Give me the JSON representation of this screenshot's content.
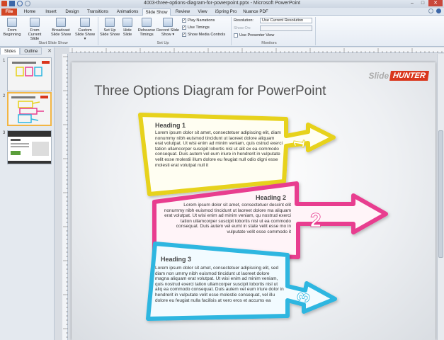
{
  "window": {
    "title": "4003-three-options-diagram-for-powerpoint.pptx - Microsoft PowerPoint",
    "min": "–",
    "max": "□",
    "close": "✕"
  },
  "tabs": [
    {
      "label": "File"
    },
    {
      "label": "Home"
    },
    {
      "label": "Insert"
    },
    {
      "label": "Design"
    },
    {
      "label": "Transitions"
    },
    {
      "label": "Animations"
    },
    {
      "label": "Slide Show"
    },
    {
      "label": "Review"
    },
    {
      "label": "View"
    },
    {
      "label": "iSpring Pro"
    },
    {
      "label": "Nuance PDF"
    }
  ],
  "ribbon": {
    "from_beginning": "From Beginning",
    "from_current": "From Current Slide",
    "broadcast": "Broadcast Slide Show",
    "custom": "Custom Slide Show ▾",
    "group_start": "Start Slide Show",
    "setup": "Set Up Slide Show",
    "hide": "Hide Slide",
    "rehearse": "Rehearse Timings",
    "record": "Record Slide Show ▾",
    "group_setup": "Set Up",
    "play_narrations": "Play Narrations",
    "use_timings": "Use Timings",
    "show_media": "Show Media Controls",
    "resolution_label": "Resolution:",
    "resolution_value": "Use Current Resolution",
    "show_on_label": "Show On:",
    "presenter_view": "Use Presenter View",
    "group_monitors": "Monitors"
  },
  "pane": {
    "tab_slides": "Slides",
    "tab_outline": "Outline",
    "close": "✕",
    "nums": [
      "1",
      "2",
      "3"
    ]
  },
  "slide": {
    "title": "Three Options Diagram for PowerPoint",
    "logo_a": "Slide",
    "logo_b": "HUNTER",
    "options": [
      {
        "heading": "Heading 1",
        "number": "1",
        "color": "#e7d21a",
        "text": "Lorem ipsum dolor sit amet, consectetuer adipiscing elit, diam nonummy nibh euismod tincidunt ut laoreet dolore aliquam erat volutpat. Ut wisi enim ad minim veniam, quis ostrud exerci tation ullamcorper suscipit lobortis nisl ut alit ex ea commodo consequat. Duis autem vel eum iriure in hendrerit in vulputate velit esse molestii illum dolore eu feugiat null odio digni esse molesti erat volutpat null it"
      },
      {
        "heading": "Heading 2",
        "number": "2",
        "color": "#e83d8f",
        "text": "Lorem ipsum dolor sit amet, consectetuer descint elit nonummy nibh euismod tincidunt ut laoreet dolore ma aliquam erat volutpat. Ut wisi enim ad minim veniam, qu nostrud exerci tation ullamcorper suscipit lobortis nisl ut ea commodo consequat. Duis autem vel eumt in state velit esse mo in vulputate velit esse commodo it"
      },
      {
        "heading": "Heading 3",
        "number": "3",
        "color": "#2fb6e0",
        "text": "Lorem ipsum dolor sit amet, consectetuer adipiscing elit, sed diam non ummy nibh euismod tincidunt ut laoreet dolore magna aliquam erat volutpat. Ut wisi enim ad minim veniam, quis nostrud exerci tation ullamcorper suscipit lobortis nisl ut aliq ea commodo consequat. Duis autem vel eum iriure dolor in hendrerit in vulputate velit esse molestie consequat, vel illu dolore eu feugiat nulla facilisis at vero eros et accums ea"
      }
    ]
  }
}
